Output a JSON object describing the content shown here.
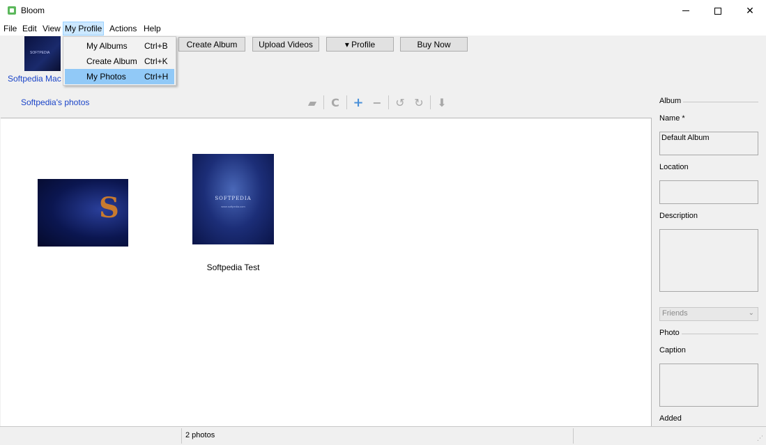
{
  "window": {
    "title": "Bloom",
    "minimize": "—",
    "close": "✕"
  },
  "menu": [
    "File",
    "Edit",
    "View",
    "My Profile",
    "Actions",
    "Help"
  ],
  "dropdown": [
    {
      "label": "My Albums",
      "shortcut": "Ctrl+B"
    },
    {
      "label": "Create Album",
      "shortcut": "Ctrl+K"
    },
    {
      "label": "My Photos",
      "shortcut": "Ctrl+H"
    }
  ],
  "profile": {
    "name": "Softpedia Mac Test",
    "thumb_text": "SOFTPEDIA"
  },
  "toolbar": {
    "create_album": "Create Album",
    "upload_videos": "Upload Videos",
    "profile": "▾ Profile",
    "buy_now": "Buy Now"
  },
  "photos_link": "Softpedia's photos",
  "icons": [
    "folder-icon",
    "refresh-icon",
    "add-icon",
    "remove-icon",
    "rotate-left-icon",
    "rotate-right-icon",
    "download-icon"
  ],
  "photos": [
    {
      "caption": "",
      "art": "S"
    },
    {
      "caption": "Softpedia Test",
      "art": "SOFTPEDIA",
      "art_sub": "www.softpedia.com"
    }
  ],
  "sidebar": {
    "album_heading": "Album",
    "name_label": "Name *",
    "name_value": "Default Album",
    "location_label": "Location",
    "location_value": "",
    "description_label": "Description",
    "description_value": "",
    "privacy_value": "Friends",
    "photo_heading": "Photo",
    "caption_label": "Caption",
    "caption_value": "",
    "added_label": "Added"
  },
  "status": {
    "photo_count": "2 photos"
  },
  "colors": {
    "link": "#1a44c8",
    "menu_highlight": "#91c9f7",
    "open_menu": "#cce8ff"
  }
}
